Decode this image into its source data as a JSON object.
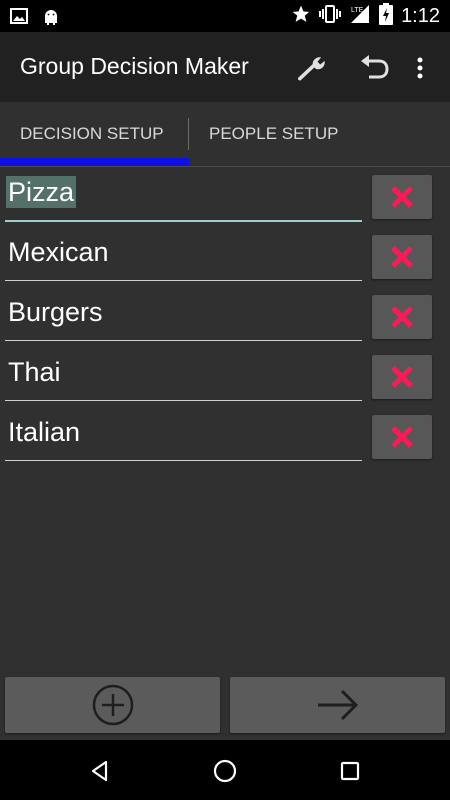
{
  "status_bar": {
    "time": "1:12",
    "left_icons": [
      "image-icon",
      "android-icon"
    ],
    "right_icons": [
      "star-icon",
      "vibrate-icon",
      "lte-signal-icon",
      "battery-charging-icon"
    ]
  },
  "action_bar": {
    "title": "Group Decision Maker",
    "icons": [
      "wrench-icon",
      "undo-icon",
      "overflow-menu-icon"
    ]
  },
  "tabs": [
    {
      "label": "DECISION SETUP",
      "selected": true
    },
    {
      "label": "PEOPLE SETUP",
      "selected": false
    }
  ],
  "options": [
    {
      "label": "Pizza",
      "selected_text": true
    },
    {
      "label": "Mexican"
    },
    {
      "label": "Burgers"
    },
    {
      "label": "Thai"
    },
    {
      "label": "Italian"
    }
  ],
  "bottom_buttons": {
    "add_icon": "add-circle-icon",
    "next_icon": "arrow-right-icon"
  },
  "colors": {
    "accent_indicator": "#0f10e6",
    "delete_x": "#ff1a57",
    "background": "#303030",
    "action_bar": "#212121"
  }
}
